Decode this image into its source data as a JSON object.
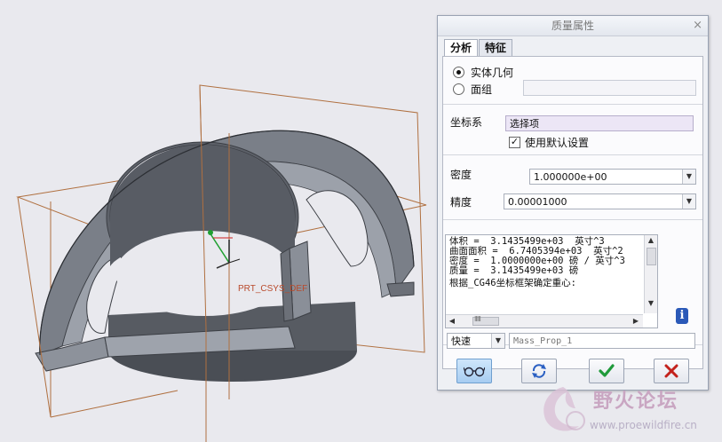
{
  "viewport": {
    "csys_label": "PRT_CSYS_DEF",
    "plane_color": "#b07040",
    "part_color": "#7a7f88"
  },
  "dialog": {
    "title": "质量属性",
    "close_glyph": "×",
    "tabs": [
      {
        "label": "分析",
        "active": true
      },
      {
        "label": "特征",
        "active": false
      }
    ],
    "geometry_options": [
      {
        "label": "实体几何",
        "selected": true
      },
      {
        "label": "面组",
        "selected": false
      }
    ],
    "quilt_value": "",
    "csys": {
      "label": "坐标系",
      "selection_placeholder": "选择项",
      "use_default_label": "使用默认设置",
      "use_default_checked": true
    },
    "density": {
      "label": "密度",
      "value": "1.000000e+00"
    },
    "accuracy": {
      "label": "精度",
      "value": "0.00001000"
    },
    "results_lines": [
      "体积 =  3.1435499e+03  英寸^3",
      "曲面面积 =  6.7405394e+03  英寸^2",
      "密度 =  1.0000000e+00 磅 / 英寸^3",
      "质量 =  3.1435499e+03 磅",
      "",
      "根据_CG46坐标框架确定重心:"
    ],
    "hscroll_glyph": "IIIII",
    "info_glyph": "i",
    "quick": {
      "mode": "快速",
      "name_placeholder": "Mass_Prop_1"
    },
    "buttons": {
      "preview_icon": "glasses-icon",
      "repeat_icon": "repeat-icon",
      "ok_icon": "checkmark-icon",
      "cancel_icon": "x-icon",
      "ok_color": "#1f9a3a",
      "cancel_color": "#c3221c"
    }
  },
  "watermark": {
    "title": "野火论坛",
    "url": "www.proewildfire.cn"
  }
}
